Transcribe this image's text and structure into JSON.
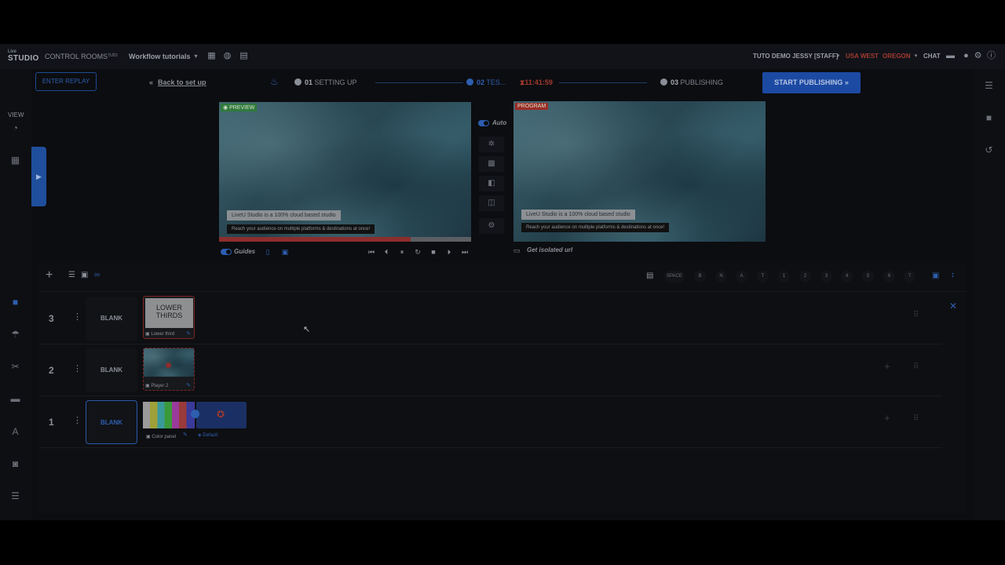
{
  "topbar": {
    "logo_top": "Live",
    "logo_bottom": "STUDIO",
    "control_rooms": "CONTROL ROOMS",
    "project_tag": "tuto",
    "workflow": "Workflow tutorials",
    "user": "TUTO DEMO JESSY [STAFF]",
    "region": "USA WEST",
    "zone": "OREGON",
    "chat": "CHAT"
  },
  "sidebar": {
    "view_label": "VIEW"
  },
  "workflow": {
    "enter_replay": "ENTER REPLAY",
    "back_to_setup": "Back to set up",
    "step1_num": "01",
    "step1_label": "SETTING UP",
    "step2_num": "02",
    "step2_label": "TES...",
    "timer": "11:41:59",
    "step3_num": "03",
    "step3_label": "PUBLISHING",
    "start_publishing": "START PUBLISHING"
  },
  "preview": {
    "tag": "PREVIEW",
    "lower_third_title": "LiveU Studio is a 100% cloud based studio",
    "lower_third_sub": "Reach your audience on multiple platforms & destinations at once!",
    "progress": 0.76,
    "guides_label": "Guides"
  },
  "program": {
    "tag": "PROGRAM",
    "lower_third_title": "LiveU Studio is a 100% cloud based studio",
    "lower_third_sub": "Reach your audience on multiple platforms & destinations at once!",
    "isolated_url": "Get isolated url"
  },
  "controls": {
    "auto_label": "Auto"
  },
  "shortcuts": [
    "SPACE",
    "B",
    "N",
    "A",
    "T",
    "1",
    "2",
    "3",
    "4",
    "5",
    "6",
    "7"
  ],
  "layers": [
    {
      "num": "3",
      "blank": "BLANK",
      "thumb_text_1": "LOWER",
      "thumb_text_2": "THIRDS",
      "source": "Lower third"
    },
    {
      "num": "2",
      "blank": "BLANK",
      "source": "Player 2"
    },
    {
      "num": "1",
      "blank": "BLANK",
      "source": "Color panel",
      "scene": "Default"
    }
  ],
  "colors": {
    "accent": "#2d5fb0",
    "preview_tag": "#2f7a3b",
    "program_tag": "#9a2d26",
    "alert": "#a33a2e"
  }
}
